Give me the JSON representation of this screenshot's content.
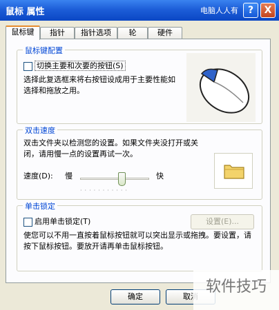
{
  "window": {
    "title": "鼠标 属性",
    "help_button": "?",
    "close_button": "X",
    "watermark_top": "电脑人人有"
  },
  "tabs": [
    {
      "label": "鼠标键",
      "active": true
    },
    {
      "label": "指针"
    },
    {
      "label": "指针选项"
    },
    {
      "label": "轮"
    },
    {
      "label": "硬件"
    }
  ],
  "button_config": {
    "group_label": "鼠标键配置",
    "checkbox_label": "切换主要和次要的按钮(S)",
    "checked": false,
    "description": "选择此复选框来将右按钮设成用于主要性能如选择和拖放之用。"
  },
  "double_click": {
    "group_label": "双击速度",
    "description": "双击文件夹以检测您的设置。如果文件夹没打开或关闭，请用慢一点的设置再试一次。",
    "speed_label": "速度(D):",
    "slow_label": "慢",
    "fast_label": "快",
    "speed_fraction": 0.6
  },
  "click_lock": {
    "group_label": "单击锁定",
    "checkbox_label": "启用单击锁定(T)",
    "checked": false,
    "settings_button": "设置(E)...",
    "description": "使您可以不用一直按着鼠标按钮就可以突出显示或拖拽。要设置，请按下鼠标按钮。要放开请再单击鼠标按钮。"
  },
  "footer": {
    "ok_button": "确定",
    "cancel_button": "取消"
  },
  "watermark": "软件技巧"
}
